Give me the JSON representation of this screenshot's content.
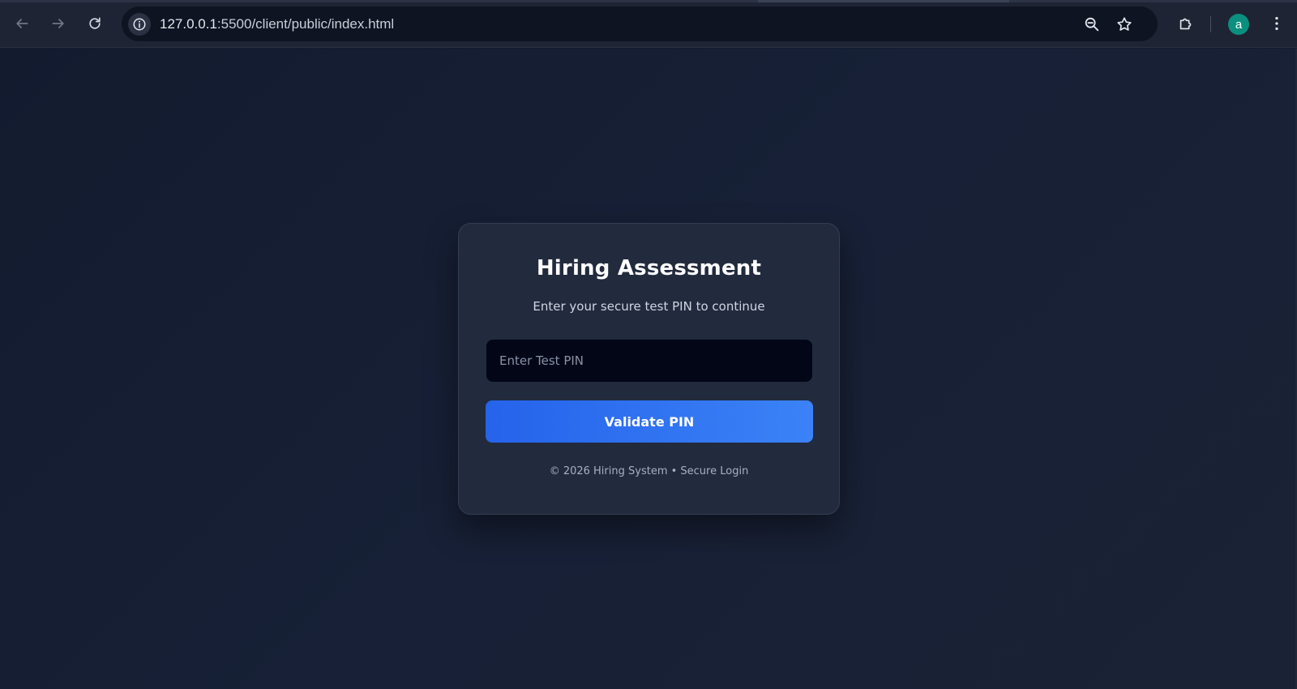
{
  "browser": {
    "url_host": "127.0.0.1",
    "url_rest": ":5500/client/public/index.html",
    "profile_initial": "a",
    "icons": {
      "back": "back-arrow-icon",
      "forward": "forward-arrow-icon",
      "reload": "reload-icon",
      "site_info": "info-icon",
      "zoom": "zoom-icon",
      "bookmark": "star-icon",
      "extensions": "puzzle-icon",
      "menu": "kebab-menu-icon"
    }
  },
  "login_card": {
    "title": "Hiring Assessment",
    "subtitle": "Enter your secure test PIN to continue",
    "pin_input": {
      "value": "",
      "placeholder": "Enter Test PIN"
    },
    "submit_label": "Validate PIN",
    "footer": "© 2026 Hiring System • Secure Login"
  },
  "colors": {
    "page_background": "#131b2e",
    "card_background": "#222a3d",
    "input_background": "#020617",
    "button_gradient_start": "#2563eb",
    "button_gradient_end": "#3b82f6",
    "avatar": "#0b8f7e"
  }
}
